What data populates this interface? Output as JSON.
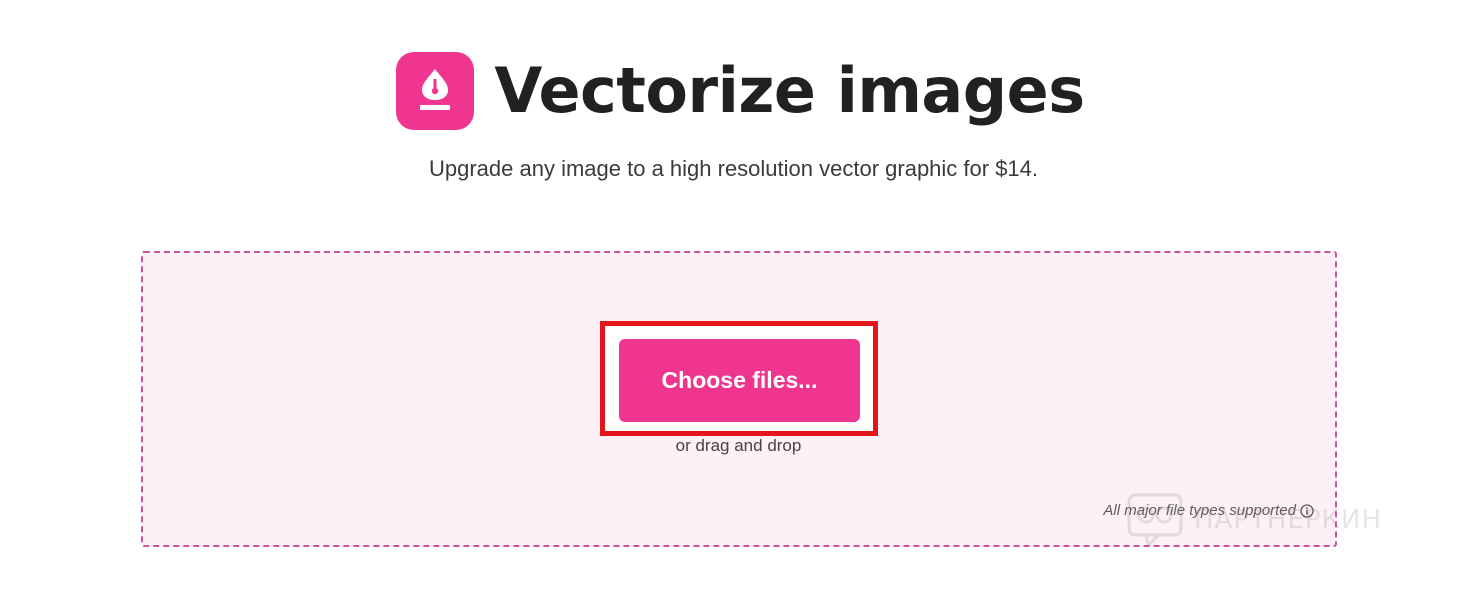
{
  "header": {
    "title": "Vectorize images",
    "logo_icon": "pen-nib-icon",
    "accent_color": "#ef3590"
  },
  "subtitle": "Upgrade any image to a high resolution vector graphic for $14.",
  "dropzone": {
    "button_label": "Choose files...",
    "drag_note": "or drag and drop",
    "file_types_note": "All major file types supported",
    "info_icon": "info-icon"
  },
  "watermark": {
    "text": "ПАРТНЕРКИН"
  }
}
